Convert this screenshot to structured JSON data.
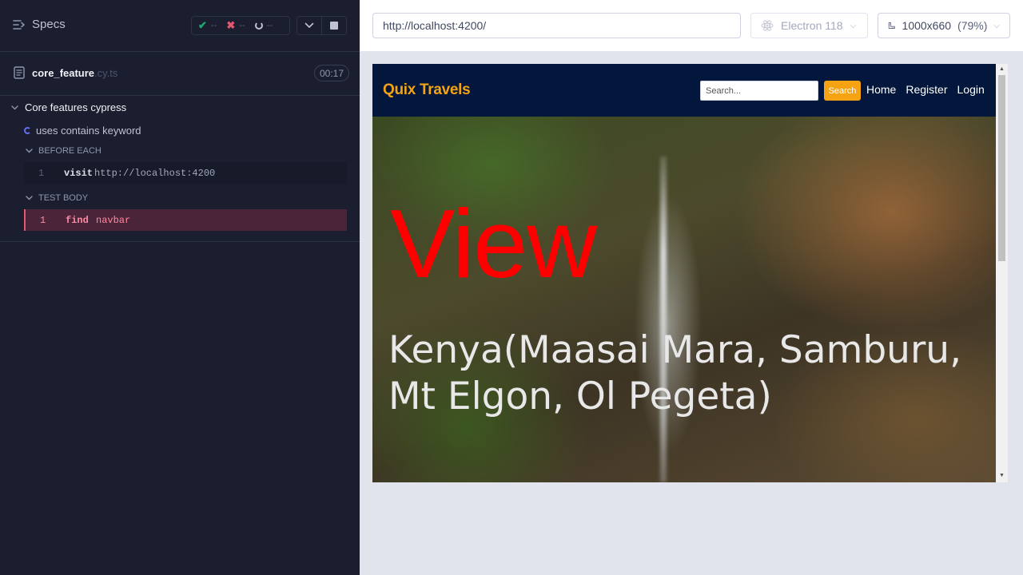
{
  "reporter": {
    "specs_label": "Specs",
    "stats": {
      "passed": "--",
      "failed": "--",
      "pending": "--"
    },
    "spec": {
      "name": "core_feature",
      "ext": ".cy.ts",
      "duration": "00:17"
    },
    "suite": {
      "title": "Core features cypress",
      "test": "uses contains keyword",
      "before_each_label": "BEFORE EACH",
      "before_each": [
        {
          "num": "1",
          "cmd": "visit",
          "arg": "http://localhost:4200"
        }
      ],
      "test_body_label": "TEST BODY",
      "test_body": [
        {
          "num": "1",
          "cmd": "find",
          "arg": "navbar"
        }
      ]
    }
  },
  "aut": {
    "url": "http://localhost:4200/",
    "browser": "Electron 118",
    "viewport": "1000x660",
    "scale": "(79%)"
  },
  "site": {
    "brand": "Quix Travels",
    "search_placeholder": "Search...",
    "search_button": "Search",
    "nav_links": [
      "Home",
      "Register",
      "Login"
    ],
    "hero_title": "View",
    "hero_subtitle": "Kenya(Maasai Mara, Samburu, Mt Elgon, Ol Pegeta)"
  },
  "colors": {
    "brand": "#f5a312",
    "nav_bg": "#03173d",
    "hero_title": "#ff0000",
    "reporter_bg": "#1b1e2e",
    "fail_highlight": "#e45770"
  }
}
